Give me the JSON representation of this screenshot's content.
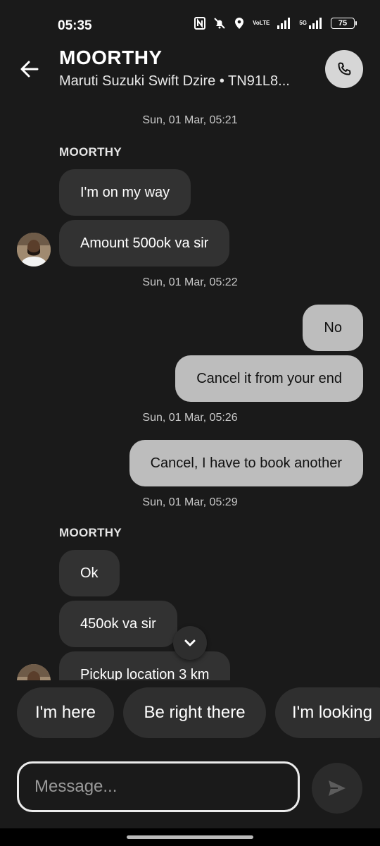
{
  "status_bar": {
    "time": "05:35",
    "icons": [
      "nfc-icon",
      "bell-off-icon",
      "location-icon",
      "volte-icon",
      "signal-icon",
      "5g-signal-icon"
    ],
    "volte_label": "VoLTE",
    "network_label": "5G",
    "battery": "75"
  },
  "header": {
    "name": "MOORTHY",
    "subtitle": "Maruti Suzuki Swift Dzire • TN91L8..."
  },
  "chat": {
    "timestamps": [
      "Sun, 01 Mar, 05:21",
      "Sun, 01 Mar, 05:22",
      "Sun, 01 Mar, 05:26",
      "Sun, 01 Mar, 05:29"
    ],
    "sender_name": "MOORTHY",
    "messages": [
      {
        "text": "I'm on my way",
        "direction": "incoming"
      },
      {
        "text": "Amount 500ok va sir",
        "direction": "incoming"
      },
      {
        "text": "No",
        "direction": "outgoing"
      },
      {
        "text": "Cancel it from your end",
        "direction": "outgoing"
      },
      {
        "text": "Cancel, I have to book another",
        "direction": "outgoing"
      },
      {
        "text": "Ok",
        "direction": "incoming"
      },
      {
        "text": "450ok va sir",
        "direction": "incoming"
      },
      {
        "text": "Pickup location 3 km",
        "direction": "incoming"
      }
    ]
  },
  "quick_replies": [
    "I'm here",
    "Be right there",
    "I'm looking"
  ],
  "composer": {
    "placeholder": "Message..."
  },
  "colors": {
    "background": "#1a1a1a",
    "incoming_bubble": "#323232",
    "outgoing_bubble": "#bdbdbd",
    "chip": "#2f2f2f",
    "call_button": "#d6d6d6"
  }
}
